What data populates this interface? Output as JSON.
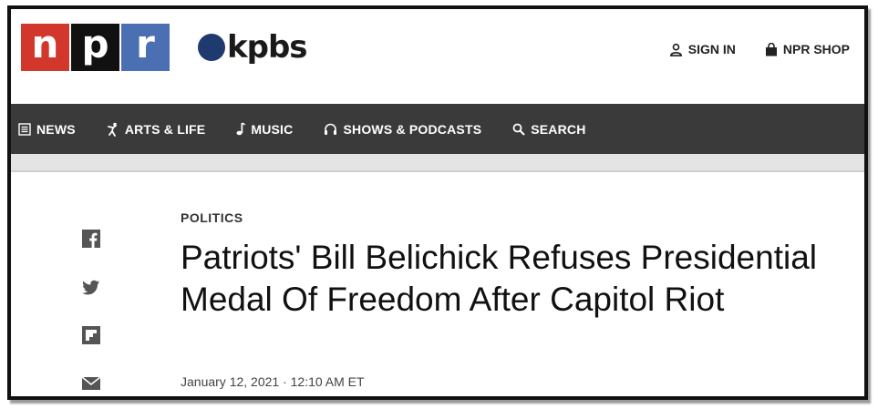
{
  "brand": {
    "logo_letters": [
      "n",
      "p",
      "r"
    ],
    "station": "kpbs"
  },
  "header": {
    "sign_in": "SIGN IN",
    "shop": "NPR SHOP"
  },
  "nav": {
    "items": [
      {
        "label": "NEWS",
        "icon": "news-icon"
      },
      {
        "label": "ARTS & LIFE",
        "icon": "arts-life-icon"
      },
      {
        "label": "MUSIC",
        "icon": "music-note-icon"
      },
      {
        "label": "SHOWS & PODCASTS",
        "icon": "headphones-icon"
      },
      {
        "label": "SEARCH",
        "icon": "search-icon"
      }
    ]
  },
  "social": [
    "facebook-icon",
    "twitter-icon",
    "flipboard-icon",
    "email-icon"
  ],
  "article": {
    "section": "POLITICS",
    "headline": "Patriots' Bill Belichick Refuses Presidential Medal Of Freedom After Capitol Riot",
    "date": "January 12, 2021 · 12:10 AM ET"
  },
  "colors": {
    "npr_red": "#d2372c",
    "npr_black": "#111111",
    "npr_blue": "#4a6fb3",
    "nav_bg": "#3a3a3a",
    "kpbs_dot": "#1f3a6e"
  }
}
